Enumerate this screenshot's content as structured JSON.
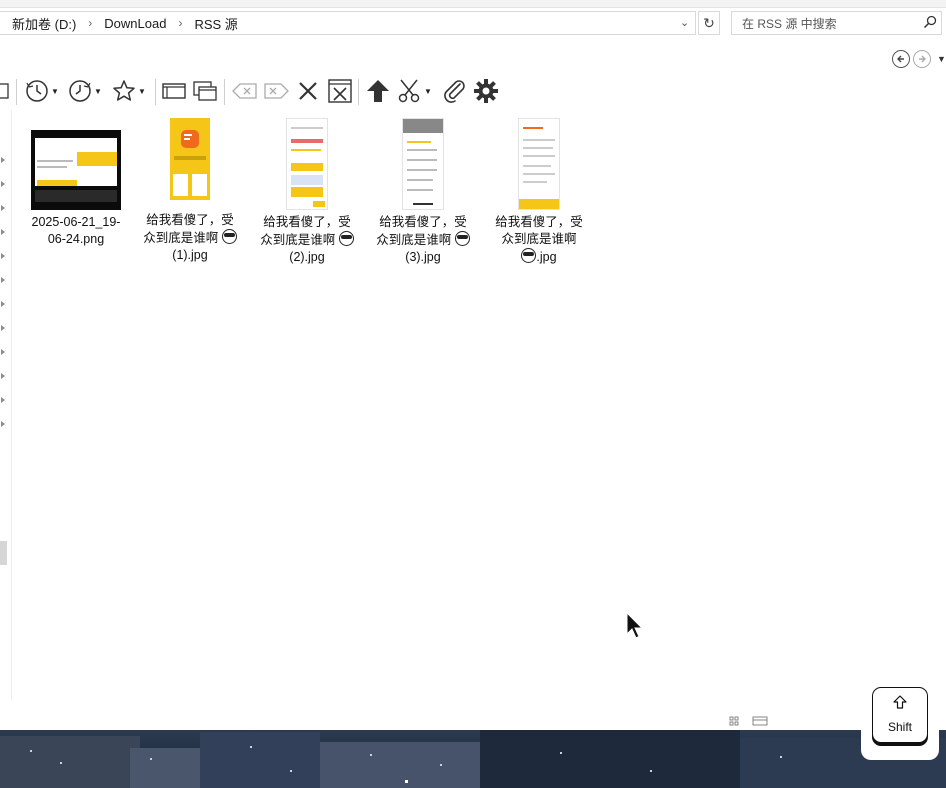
{
  "address_bar": {
    "breadcrumbs": [
      "新加卷 (D:)",
      "DownLoad",
      "RSS 源"
    ]
  },
  "search": {
    "placeholder": "在 RSS 源 中搜索"
  },
  "toolbar": {
    "icons": [
      "checkbox-icon",
      "recent-clock-icon",
      "history-clock-icon",
      "favorite-star-icon",
      "pane-icon",
      "window-icon",
      "backspace-icon",
      "delete-icon",
      "close-icon",
      "close-window-icon",
      "up-arrow-icon",
      "cut-scissors-icon",
      "attach-clip-icon",
      "settings-gear-icon"
    ]
  },
  "files": [
    {
      "name": "2025-06-21_19-06-24.png",
      "line1": "2025-06-21_19-",
      "line2": "06-24.png",
      "line3": "",
      "emoji_line": 0
    },
    {
      "name": "给我看傻了，受众到底是谁啊 (1).jpg",
      "line1": "给我看傻了，受",
      "line2": "众到底是谁啊",
      "line3": "(1).jpg",
      "emoji_line": 2
    },
    {
      "name": "给我看傻了，受众到底是谁啊 (2).jpg",
      "line1": "给我看傻了，受",
      "line2": "众到底是谁啊",
      "line3": "(2).jpg",
      "emoji_line": 2
    },
    {
      "name": "给我看傻了，受众到底是谁啊 (3).jpg",
      "line1": "给我看傻了，受",
      "line2": "众到底是谁啊",
      "line3": "(3).jpg",
      "emoji_line": 2
    },
    {
      "name": "给我看傻了，受众到底是谁啊.jpg",
      "line1": "给我看傻了，受",
      "line2": "众到底是谁啊",
      "line3": ".jpg",
      "emoji_line": 3
    }
  ],
  "key_overlay": {
    "label": "Shift"
  },
  "colors": {
    "accent_yellow": "#f5c518",
    "orange": "#f06a1d",
    "text": "#1a1a1a"
  }
}
